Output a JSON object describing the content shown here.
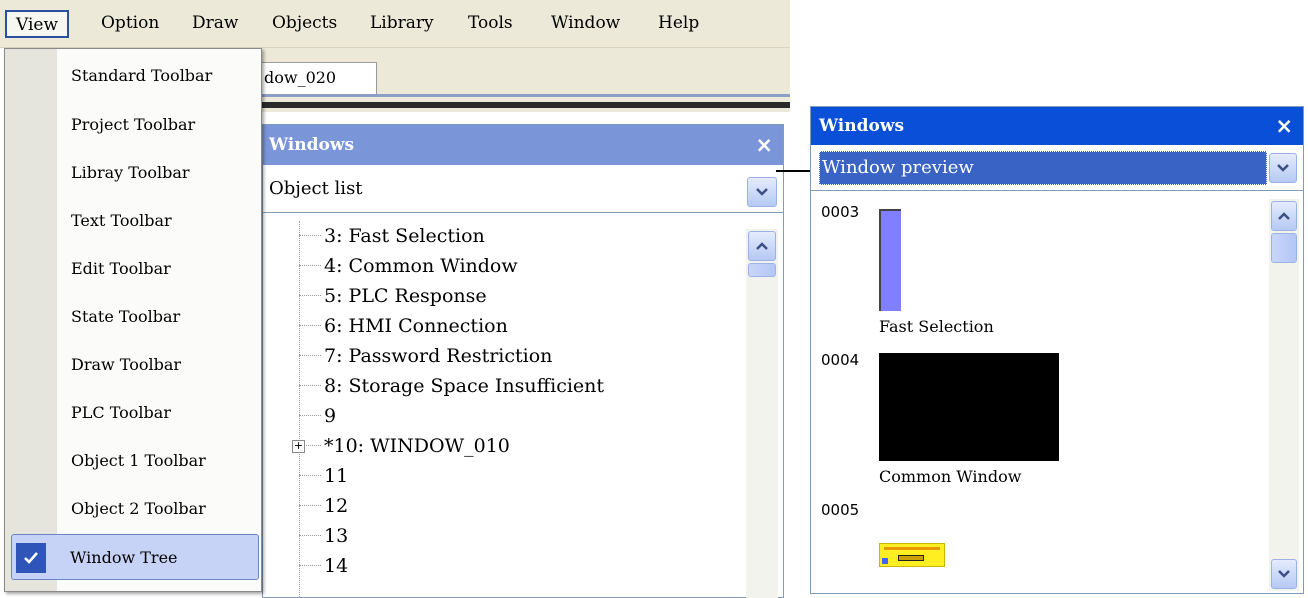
{
  "menubar": {
    "items": [
      {
        "label": "View",
        "active": true
      },
      {
        "label": "Option"
      },
      {
        "label": "Draw"
      },
      {
        "label": "Objects"
      },
      {
        "label": "Library"
      },
      {
        "label": "Tools"
      },
      {
        "label": "Window"
      },
      {
        "label": "Help"
      }
    ]
  },
  "document_tab": {
    "label": "dow_020"
  },
  "view_menu": {
    "items": [
      {
        "label": "Standard Toolbar"
      },
      {
        "label": "Project Toolbar"
      },
      {
        "label": "Libray Toolbar"
      },
      {
        "label": "Text Toolbar"
      },
      {
        "label": "Edit Toolbar"
      },
      {
        "label": "State Toolbar"
      },
      {
        "label": "Draw Toolbar"
      },
      {
        "label": "PLC Toolbar"
      },
      {
        "label": "Object 1 Toolbar"
      },
      {
        "label": "Object 2 Toolbar"
      },
      {
        "label": "Window Tree",
        "checked": true
      }
    ]
  },
  "panel_left": {
    "title": "Windows",
    "close_icon": "×",
    "combo_value": "Object list",
    "tree": [
      {
        "label": "3: Fast Selection"
      },
      {
        "label": "4: Common Window"
      },
      {
        "label": "5: PLC Response"
      },
      {
        "label": "6: HMI Connection"
      },
      {
        "label": "7: Password Restriction"
      },
      {
        "label": "8: Storage Space Insufficient"
      },
      {
        "label": "9"
      },
      {
        "label": "*10: WINDOW_010",
        "expander": "+"
      },
      {
        "label": "11"
      },
      {
        "label": "12"
      },
      {
        "label": "13"
      },
      {
        "label": "14"
      }
    ]
  },
  "panel_right": {
    "title": "Windows",
    "close_icon": "×",
    "combo_value": "Window preview",
    "previews": [
      {
        "number": "0003",
        "name": "Fast Selection"
      },
      {
        "number": "0004",
        "name": "Common Window"
      },
      {
        "number": "0005",
        "name": ""
      }
    ]
  },
  "colors": {
    "left_title_bar": "#7b96d8",
    "right_title_bar": "#0a4fd8",
    "menu_highlight": "#c6d3f6",
    "fast_selection_thumb": "#7f7fff",
    "common_window_thumb": "#000000",
    "plc_response_thumb": "#ffee22"
  }
}
